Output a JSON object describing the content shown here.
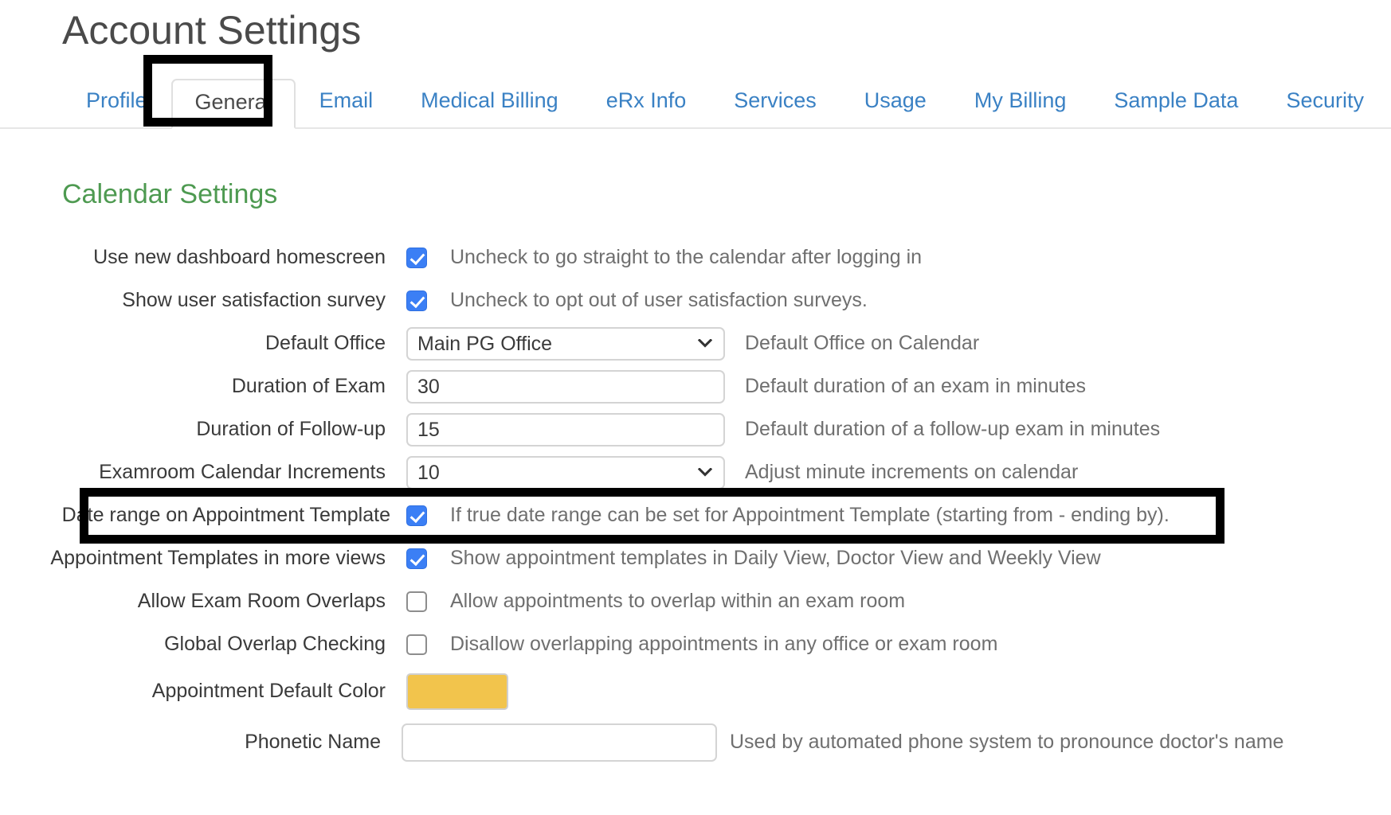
{
  "page": {
    "title": "Account Settings"
  },
  "tabs": {
    "active": "General",
    "items": [
      {
        "label": "Profile"
      },
      {
        "label": "General"
      },
      {
        "label": "Email"
      },
      {
        "label": "Medical Billing"
      },
      {
        "label": "eRx Info"
      },
      {
        "label": "Services"
      },
      {
        "label": "Usage"
      },
      {
        "label": "My Billing"
      },
      {
        "label": "Sample Data"
      },
      {
        "label": "Security"
      }
    ]
  },
  "section": {
    "heading": "Calendar Settings"
  },
  "settings": {
    "use_new_dashboard": {
      "label": "Use new dashboard homescreen",
      "checked": "checked",
      "help": "Uncheck to go straight to the calendar after logging in"
    },
    "satisfaction_survey": {
      "label": "Show user satisfaction survey",
      "checked": "checked",
      "help": "Uncheck to opt out of user satisfaction surveys."
    },
    "default_office": {
      "label": "Default Office",
      "value": "Main PG Office",
      "help": "Default Office on Calendar",
      "icon": "chevron-down-icon"
    },
    "duration_exam": {
      "label": "Duration of Exam",
      "value": "30",
      "help": "Default duration of an exam in minutes"
    },
    "duration_followup": {
      "label": "Duration of Follow-up",
      "value": "15",
      "help": "Default duration of a follow-up exam in minutes"
    },
    "examroom_increments": {
      "label": "Examroom Calendar Increments",
      "value": "10",
      "help": "Adjust minute increments on calendar",
      "icon": "chevron-down-icon"
    },
    "date_range_template": {
      "label": "Date range on Appointment Template",
      "checked": "checked",
      "help": "If true date range can be set for Appointment Template (starting from - ending by)."
    },
    "templates_more_views": {
      "label": "Appointment Templates in more views",
      "checked": "checked",
      "help": "Show appointment templates in Daily View, Doctor View and Weekly View"
    },
    "exam_room_overlaps": {
      "label": "Allow Exam Room Overlaps",
      "checked": "",
      "help": "Allow appointments to overlap within an exam room"
    },
    "global_overlap": {
      "label": "Global Overlap Checking",
      "checked": "",
      "help": "Disallow overlapping appointments in any office or exam room"
    },
    "default_color": {
      "label": "Appointment Default Color",
      "value": "#f2c44c",
      "help": ""
    },
    "phonetic_name": {
      "label": "Phonetic Name",
      "value": "",
      "placeholder": "",
      "help": "Used by automated phone system to pronounce doctor's name"
    }
  },
  "colors": {
    "tab_link": "#3a81c4",
    "section_heading": "#4e9a51",
    "checkbox_on": "#3b7ff5",
    "appointment_default_color": "#f2c44c",
    "annotation": "#000000"
  }
}
